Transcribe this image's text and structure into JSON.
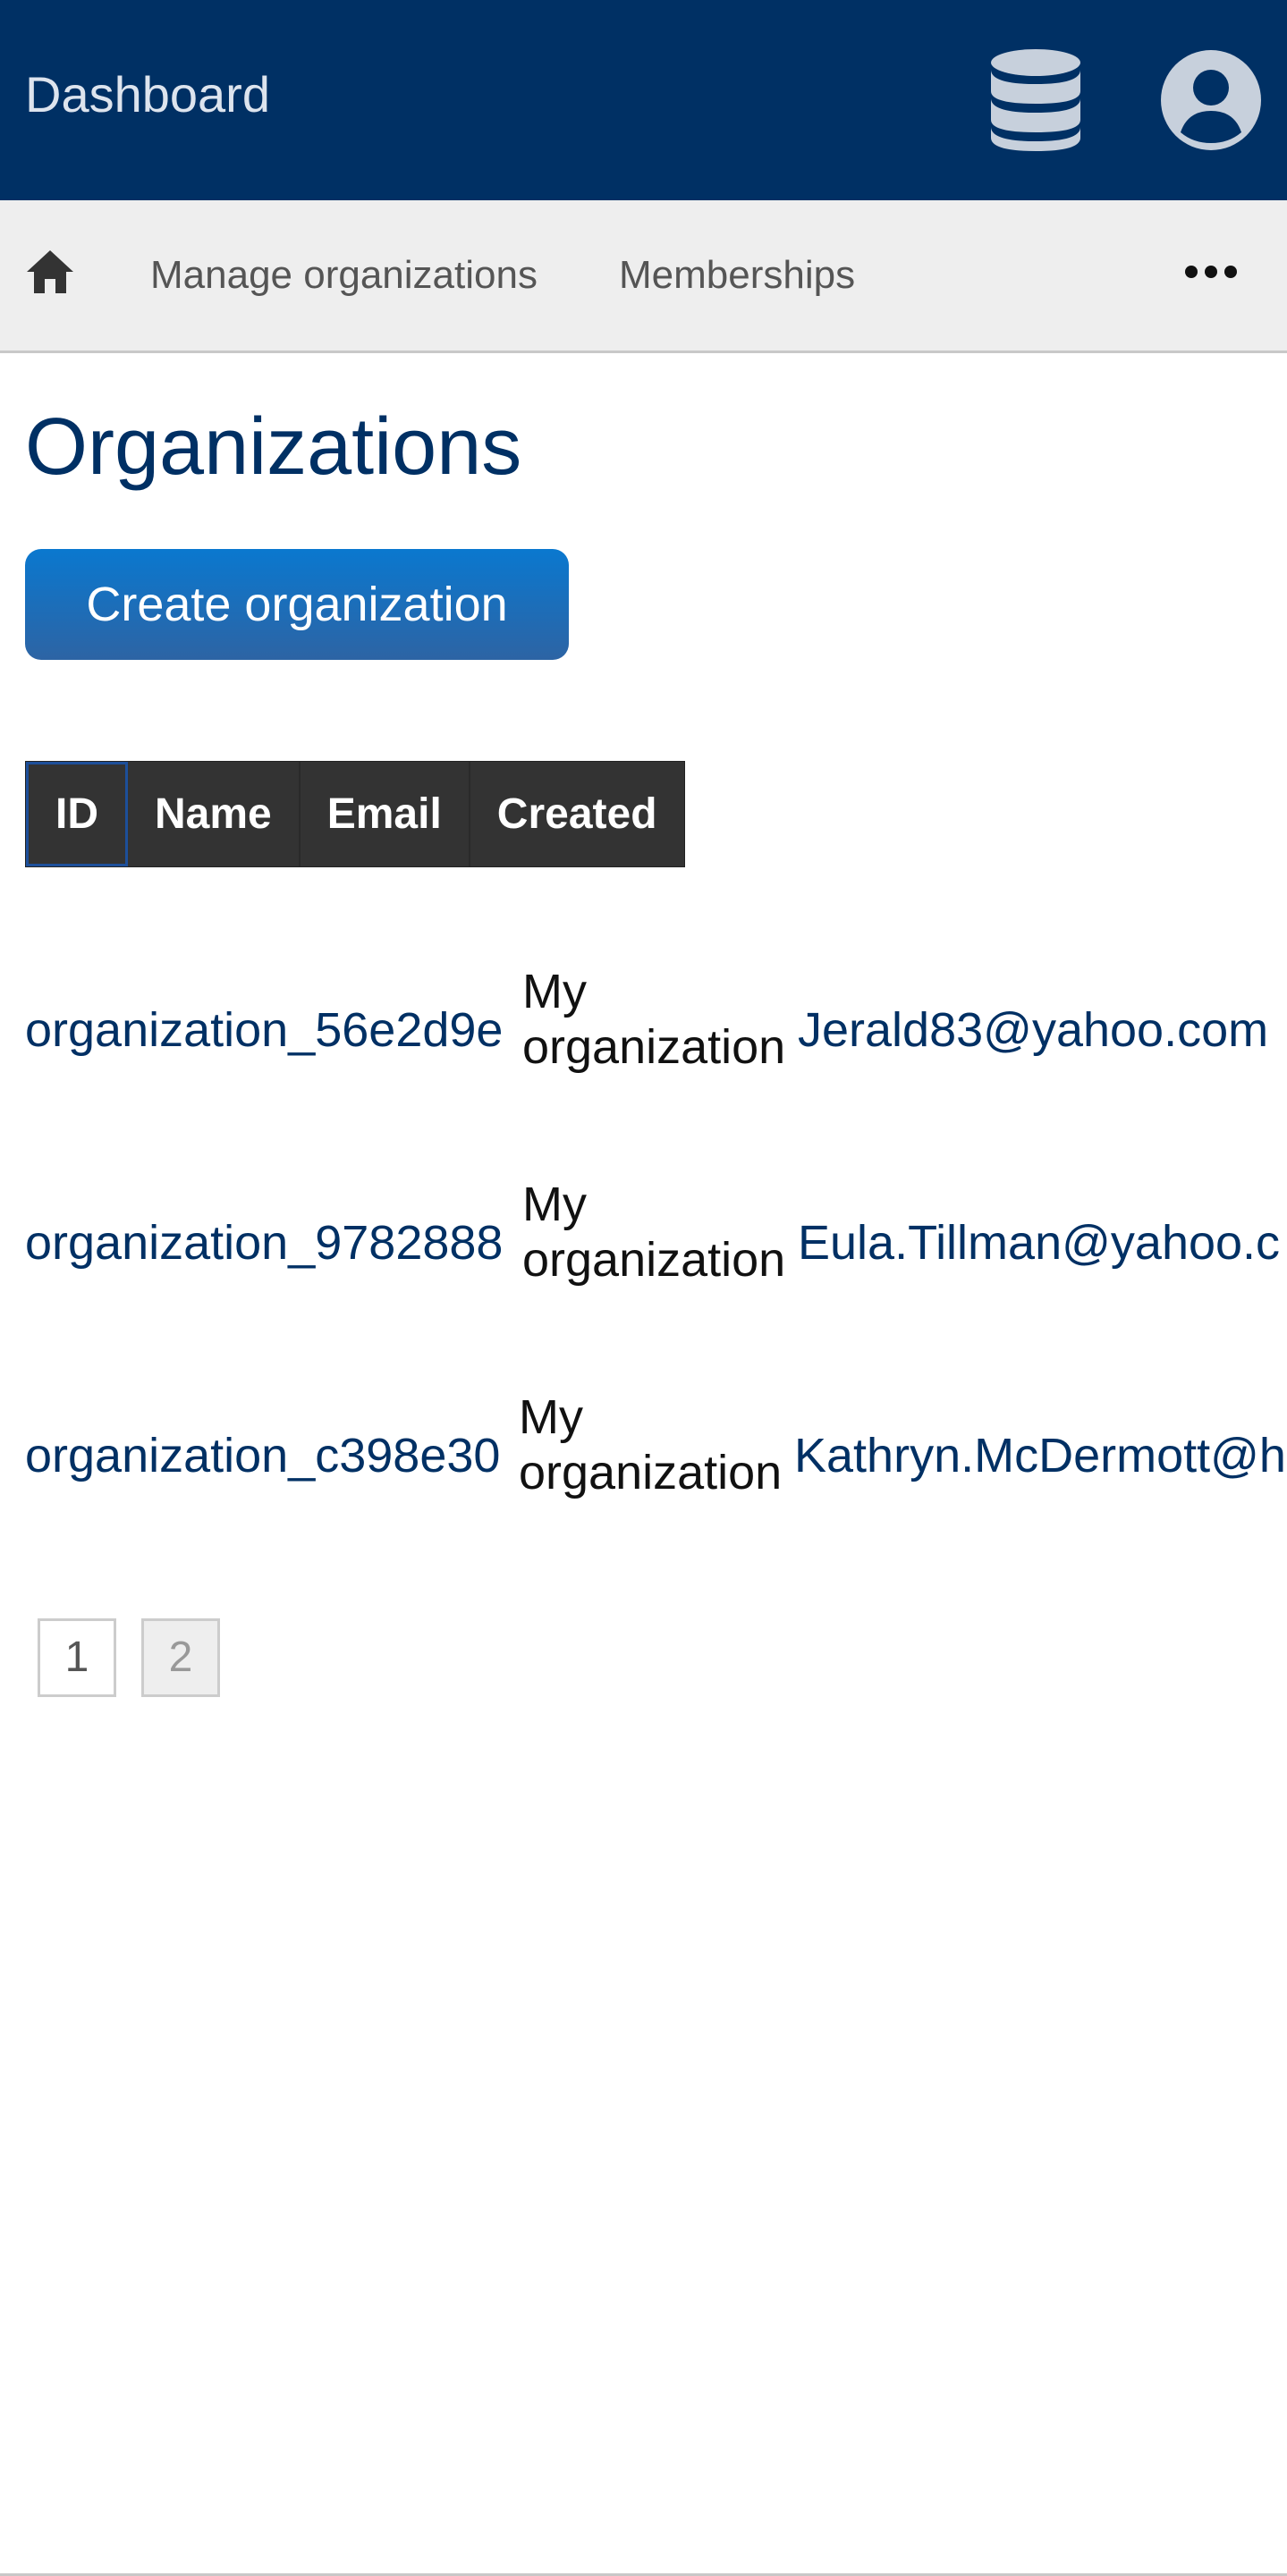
{
  "header": {
    "brand": "Dashboard",
    "icons": [
      "database-icon",
      "user-account-icon"
    ],
    "colors": {
      "background": "#003064",
      "brand_text": "#dde4ee",
      "icon": "#c7d0dc"
    }
  },
  "nav": {
    "home_icon": "home-icon",
    "items": [
      {
        "label": "Manage organizations"
      },
      {
        "label": "Memberships"
      }
    ],
    "more_icon": "ellipsis-icon"
  },
  "main": {
    "title": "Organizations",
    "create_button": "Create organization",
    "table": {
      "columns": [
        "ID",
        "Name",
        "Email",
        "Created"
      ],
      "rows": [
        {
          "id": "organization_56e2d9e",
          "name": "My organization",
          "email": "Jerald83@yahoo.com"
        },
        {
          "id": "organization_9782888",
          "name": "My organization",
          "email": "Eula.Tillman@yahoo.c"
        },
        {
          "id": "organization_c398e30",
          "name": "My organization",
          "email": "Kathryn.McDermott@h"
        }
      ]
    },
    "pagination": {
      "pages": [
        "1",
        "2"
      ],
      "current": "2"
    }
  },
  "theme": {
    "accent": "#0a78cf",
    "link": "#003064",
    "table_header": "#333333"
  }
}
